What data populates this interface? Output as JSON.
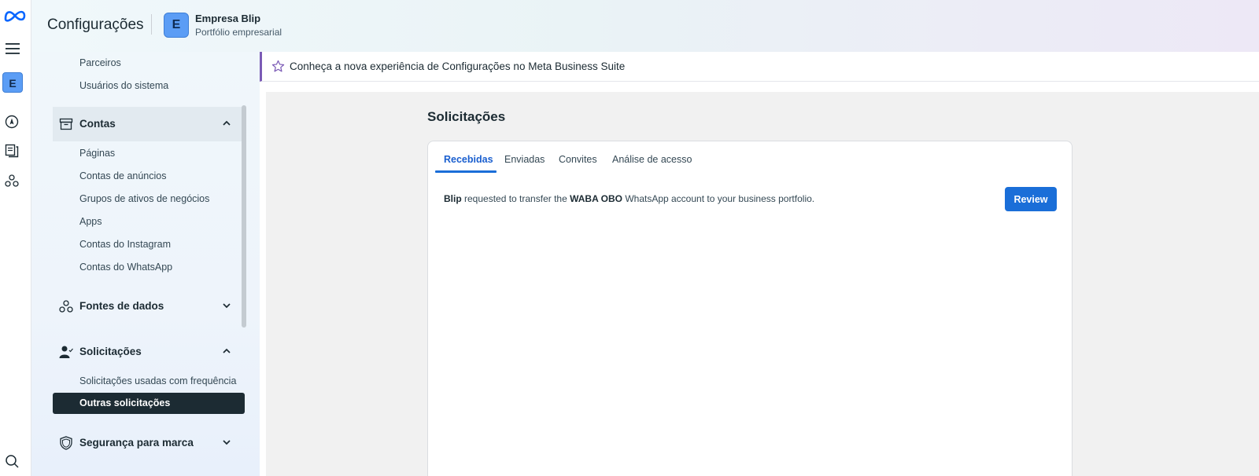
{
  "header": {
    "title": "Configurações",
    "company_initial": "E",
    "business_name": "Empresa Blip",
    "business_subtitle": "Portfólio empresarial"
  },
  "rail": {
    "company_initial": "E",
    "icons": [
      "meta-logo",
      "menu-icon",
      "compass-icon",
      "pages-icon",
      "network-icon",
      "search-icon"
    ]
  },
  "sidebar": {
    "top_items": [
      "Parceiros",
      "Usuários do sistema"
    ],
    "contas": {
      "label": "Contas",
      "items": [
        "Páginas",
        "Contas de anúncios",
        "Grupos de ativos de negócios",
        "Apps",
        "Contas do Instagram",
        "Contas do WhatsApp"
      ]
    },
    "fontes": {
      "label": "Fontes de dados"
    },
    "solicitacoes": {
      "label": "Solicitações",
      "items": [
        "Solicitações usadas com frequência"
      ],
      "selected": "Outras solicitações"
    },
    "seguranca": {
      "label": "Segurança para marca"
    }
  },
  "banner": {
    "text": "Conheça a nova experiência de Configurações no Meta Business Suite"
  },
  "main": {
    "title": "Solicitações",
    "tabs": [
      "Recebidas",
      "Enviadas",
      "Convites",
      "Análise de acesso"
    ],
    "active_tab": "Recebidas",
    "request": {
      "sender": "Blip",
      "text1": " requested to transfer the ",
      "asset": "WABA OBO",
      "text2": " WhatsApp account to your business portfolio."
    },
    "review_label": "Review"
  },
  "colors": {
    "accent": "#1a6ed8",
    "selected_bg": "#1c2b33",
    "banner_accent": "#7b5bb6"
  }
}
